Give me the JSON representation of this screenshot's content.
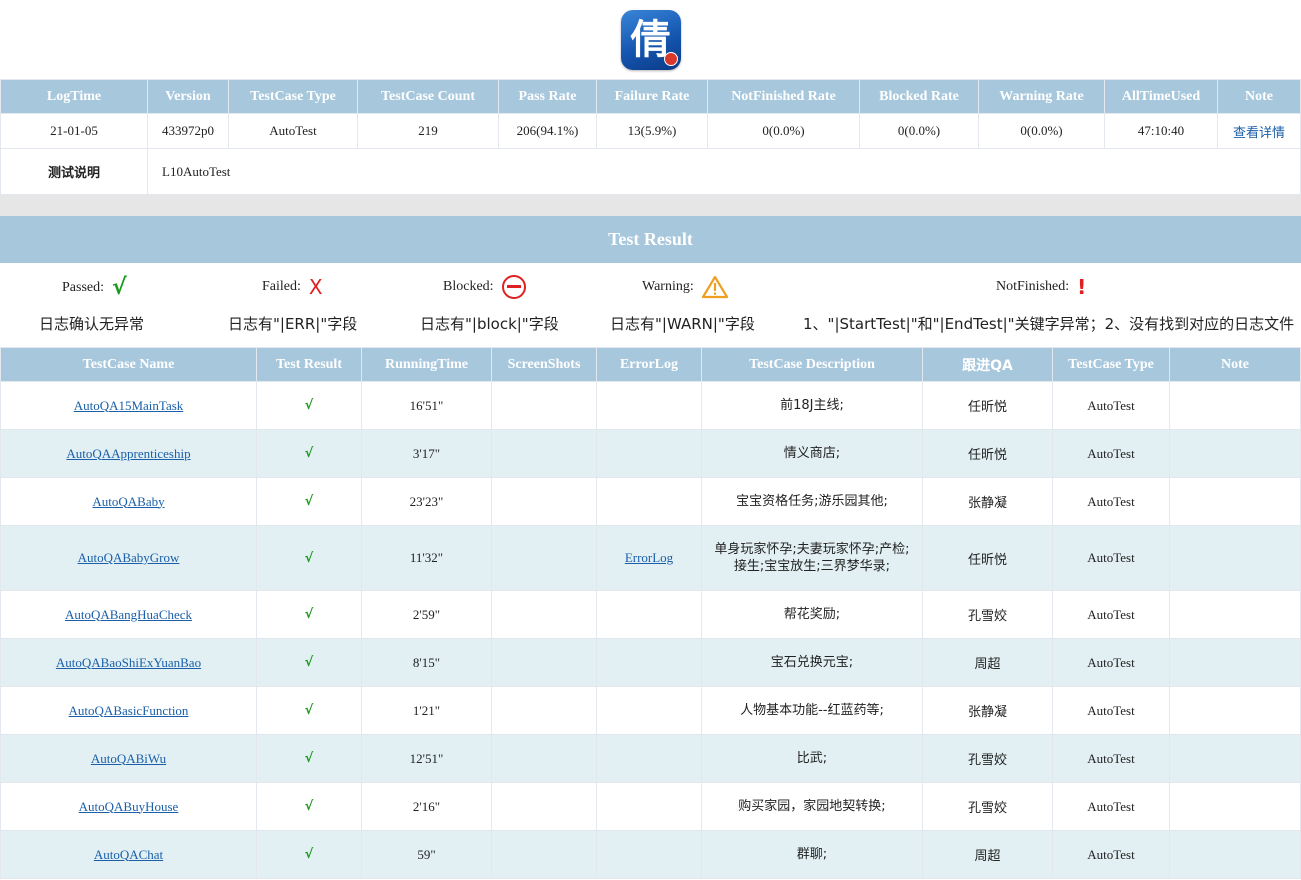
{
  "logo": {
    "char": "倩",
    "icon": "game-app-logo"
  },
  "summary": {
    "headers": [
      "LogTime",
      "Version",
      "TestCase Type",
      "TestCase Count",
      "Pass Rate",
      "Failure Rate",
      "NotFinished Rate",
      "Blocked Rate",
      "Warning Rate",
      "AllTimeUsed",
      "Note"
    ],
    "row": {
      "log_time": "21-01-05",
      "version": "433972p0",
      "testcase_type": "AutoTest",
      "testcase_count": "219",
      "pass_rate": "206(94.1%)",
      "failure_rate": "13(5.9%)",
      "notfinished_rate": "0(0.0%)",
      "blocked_rate": "0(0.0%)",
      "warning_rate": "0(0.0%)",
      "all_time_used": "47:10:40",
      "note": "查看详情"
    },
    "desc_label": "测试说明",
    "desc_value": "L10AutoTest"
  },
  "result_title": "Test Result",
  "legend": {
    "passed": {
      "label": "Passed:",
      "symbol": "√",
      "desc": "日志确认无异常"
    },
    "failed": {
      "label": "Failed:",
      "symbol": "X",
      "desc": "日志有\"|ERR|\"字段"
    },
    "blocked": {
      "label": "Blocked:",
      "desc": "日志有\"|block|\"字段"
    },
    "warning": {
      "label": "Warning:",
      "desc": "日志有\"|WARN|\"字段"
    },
    "notfinished": {
      "label": "NotFinished:",
      "symbol": "!",
      "desc": "1、\"|StartTest|\"和\"|EndTest|\"关键字异常；2、没有找到对应的日志文件"
    }
  },
  "colors": {
    "header_bg": "#a7c7dc",
    "row_alt": "#e2f0f4",
    "pass": "#1a9a1a",
    "fail": "#e02020",
    "link": "#1a5fa8",
    "warning": "#f0a020"
  },
  "results": {
    "headers": [
      "TestCase Name",
      "Test Result",
      "RunningTime",
      "ScreenShots",
      "ErrorLog",
      "TestCase Description",
      "跟进QA",
      "TestCase Type",
      "Note"
    ],
    "rows": [
      {
        "name": "AutoQA15MainTask",
        "result": "√",
        "time": "16'51\"",
        "screenshots": "",
        "errorlog": "",
        "desc": "前18J主线;",
        "qa": "任昕悦",
        "type": "AutoTest",
        "note": ""
      },
      {
        "name": "AutoQAApprenticeship",
        "result": "√",
        "time": "3'17\"",
        "screenshots": "",
        "errorlog": "",
        "desc": "情义商店;",
        "qa": "任昕悦",
        "type": "AutoTest",
        "note": ""
      },
      {
        "name": "AutoQABaby",
        "result": "√",
        "time": "23'23\"",
        "screenshots": "",
        "errorlog": "",
        "desc": "宝宝资格任务;游乐园其他;",
        "qa": "张静凝",
        "type": "AutoTest",
        "note": ""
      },
      {
        "name": "AutoQABabyGrow",
        "result": "√",
        "time": "11'32\"",
        "screenshots": "",
        "errorlog": "ErrorLog",
        "desc": "单身玩家怀孕;夫妻玩家怀孕;产检;接生;宝宝放生;三界梦华录;",
        "qa": "任昕悦",
        "type": "AutoTest",
        "note": ""
      },
      {
        "name": "AutoQABangHuaCheck",
        "result": "√",
        "time": "2'59\"",
        "screenshots": "",
        "errorlog": "",
        "desc": "帮花奖励;",
        "qa": "孔雪姣",
        "type": "AutoTest",
        "note": ""
      },
      {
        "name": "AutoQABaoShiExYuanBao",
        "result": "√",
        "time": "8'15\"",
        "screenshots": "",
        "errorlog": "",
        "desc": "宝石兑换元宝;",
        "qa": "周超",
        "type": "AutoTest",
        "note": ""
      },
      {
        "name": "AutoQABasicFunction",
        "result": "√",
        "time": "1'21\"",
        "screenshots": "",
        "errorlog": "",
        "desc": "人物基本功能--红蓝药等;",
        "qa": "张静凝",
        "type": "AutoTest",
        "note": ""
      },
      {
        "name": "AutoQABiWu",
        "result": "√",
        "time": "12'51\"",
        "screenshots": "",
        "errorlog": "",
        "desc": "比武;",
        "qa": "孔雪姣",
        "type": "AutoTest",
        "note": ""
      },
      {
        "name": "AutoQABuyHouse",
        "result": "√",
        "time": "2'16\"",
        "screenshots": "",
        "errorlog": "",
        "desc": "购买家园，家园地契转换;",
        "qa": "孔雪姣",
        "type": "AutoTest",
        "note": ""
      },
      {
        "name": "AutoQAChat",
        "result": "√",
        "time": "59\"",
        "screenshots": "",
        "errorlog": "",
        "desc": "群聊;",
        "qa": "周超",
        "type": "AutoTest",
        "note": ""
      }
    ]
  }
}
